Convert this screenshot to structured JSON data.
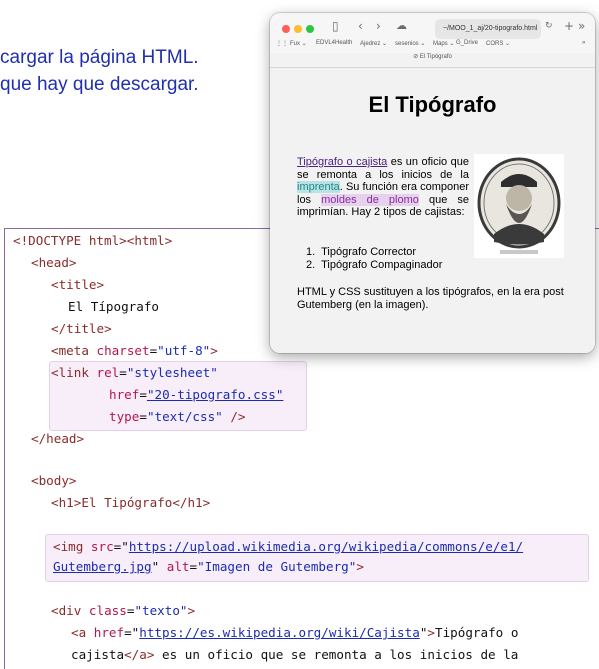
{
  "intro": {
    "line1": "cargar la página HTML.",
    "line2": "que hay que descargar."
  },
  "code": {
    "doctype": "<!DOCTYPE html><html>",
    "head_open": "<head>",
    "title_open": "<title>",
    "title_text": "El Típografo",
    "title_close": "</title>",
    "meta": {
      "tag": "<meta ",
      "attr": "charset",
      "value": "\"utf-8\"",
      "end": ">"
    },
    "link": {
      "tag": "<link ",
      "rel_attr": "rel",
      "rel_value": "\"stylesheet\"",
      "href_attr": "href",
      "href_value": "\"20-tipografo.css\"",
      "type_attr": "type",
      "type_value": "\"text/css\"",
      "end": " />"
    },
    "head_close": "</head>",
    "body_open": "<body>",
    "h1": "<h1>El Tipógrafo</h1>",
    "img": {
      "tag": "<img ",
      "src_attr": "src",
      "src_value": "https://upload.wikimedia.org/wikipedia/commons/e/e1/",
      "src_value2": "Gutemberg.jpg",
      "alt_attr": "alt",
      "alt_value": "\"Imagen de Gutemberg\"",
      "end": ">"
    },
    "div": {
      "tag": "<div ",
      "attr": "class",
      "value": "\"texto\"",
      "end": ">"
    },
    "a": {
      "tag": "<a ",
      "attr": "href",
      "value": "https://es.wikipedia.org/wiki/Cajista",
      "text": "Tipógrafo o",
      "line2_text": "cajista",
      "close": "</a>",
      "rest": " es un oficio que se remonta a los inicios de la"
    }
  },
  "browser": {
    "url": "~/MOO_1_aj/20-tipografo.html",
    "tab_title": "El Tipógrafo",
    "bookmarks": [
      "Fux ⌄",
      "EDVL4Health",
      "Ajedrez ⌄",
      "sesenios ⌄",
      "Maps ⌄",
      "G_Drive",
      "CORS ⌄"
    ],
    "page": {
      "heading": "El Tipógrafo",
      "para_link": "Tipógrafo o cajista",
      "para_1": " es un oficio que se remonta a los inicios de la ",
      "para_imprenta": "imprenta",
      "para_2": ". Su función era componer los ",
      "para_moldes": "moldes de plomo",
      "para_3": " que se imprimían. Hay 2 tipos de cajistas:",
      "list": [
        "Tipógrafo Corrector",
        "Tipógrafo Compaginador"
      ],
      "footer": "HTML y CSS sustituyen a los tipógrafos, en la era post Gutemberg (en la imagen)."
    }
  },
  "colors": {
    "tag": "#8a2b2b",
    "attr": "#b4174c",
    "string": "#1b2cb0",
    "intro": "#1f2fae"
  }
}
